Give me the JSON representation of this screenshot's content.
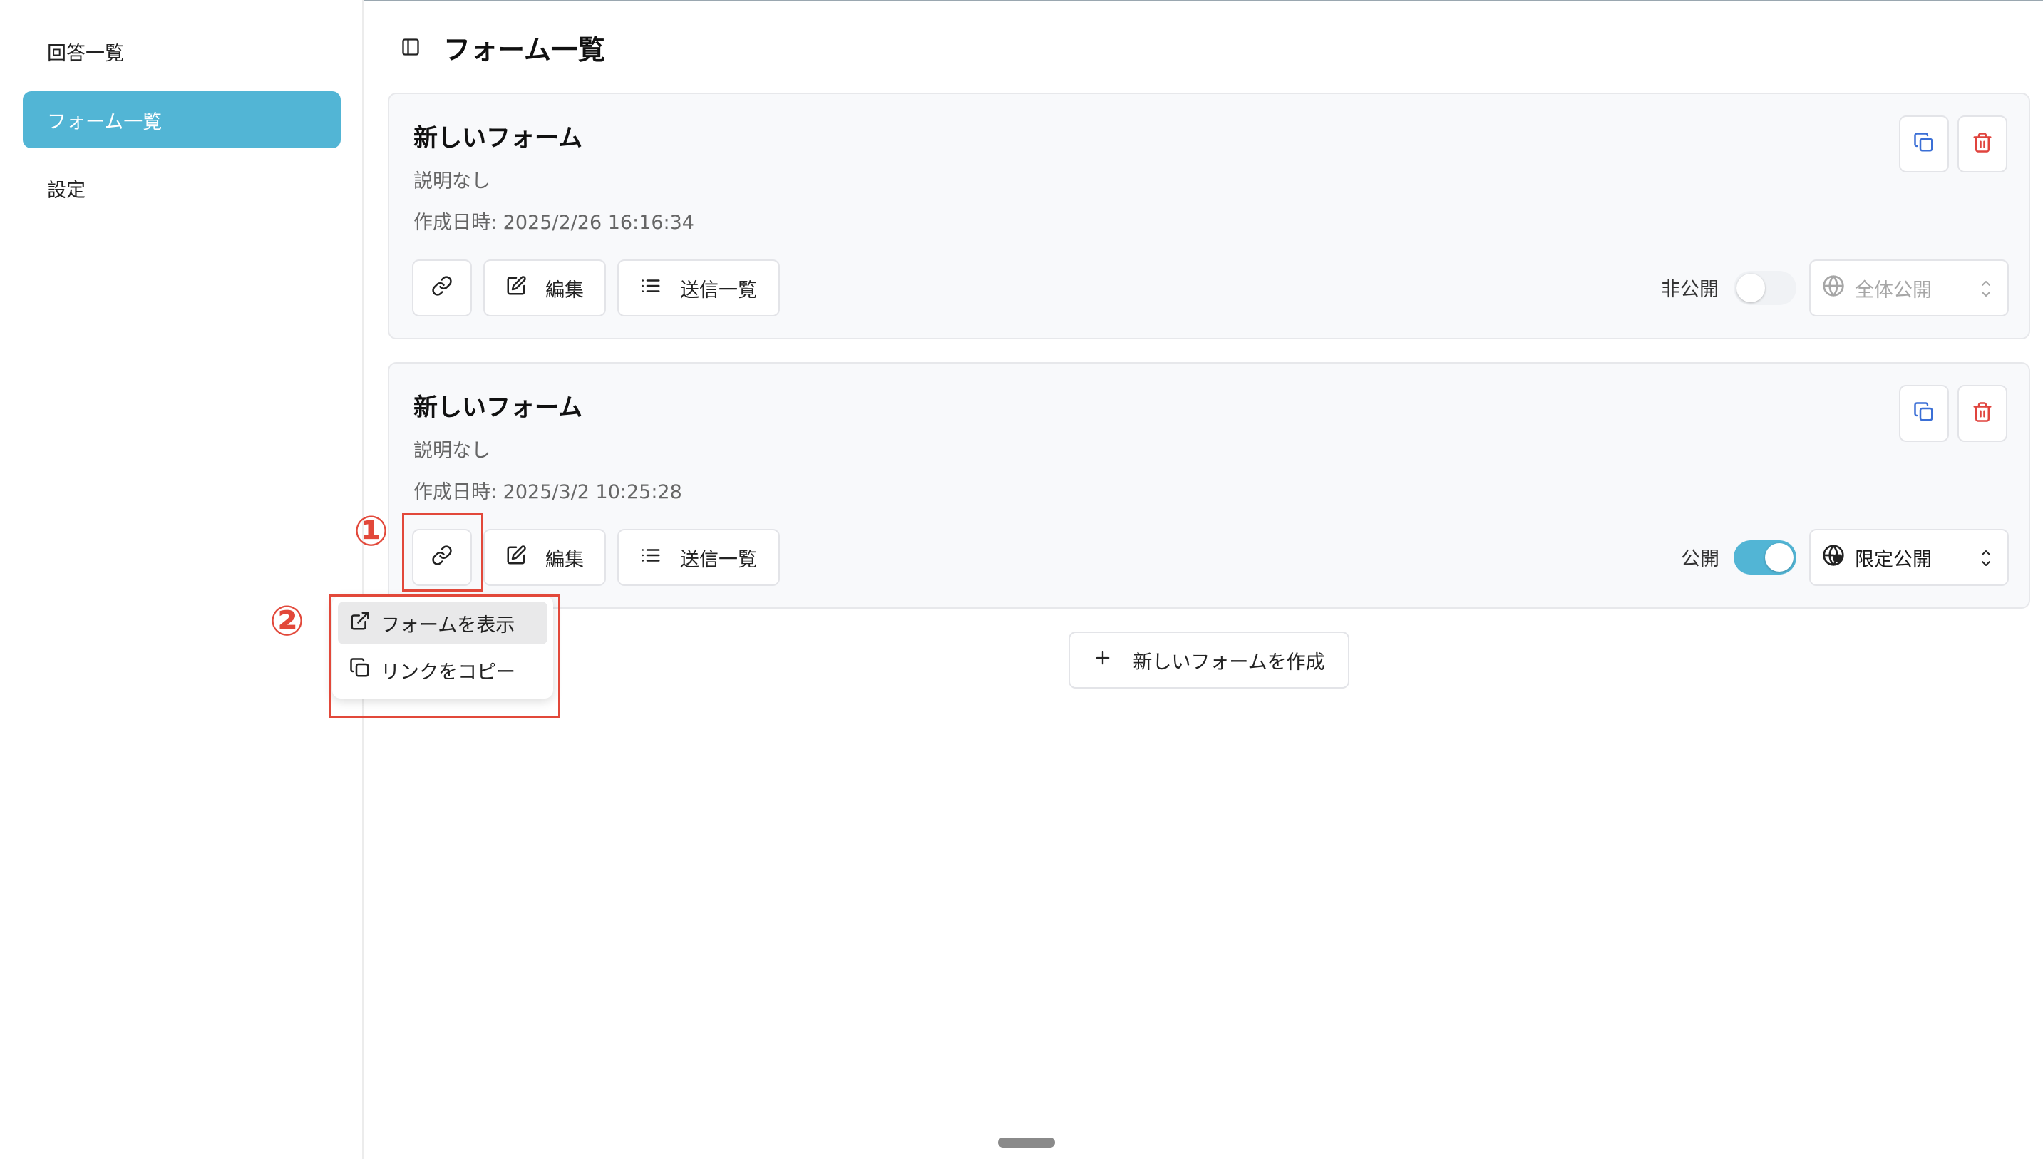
{
  "sidebar": {
    "items": [
      {
        "label": "回答一覧",
        "active": false
      },
      {
        "label": "フォーム一覧",
        "active": true
      },
      {
        "label": "設定",
        "active": false
      }
    ]
  },
  "header": {
    "title": "フォーム一覧",
    "toggle_icon": "sidebar-toggle-icon"
  },
  "forms": [
    {
      "title": "新しいフォーム",
      "description": "説明なし",
      "created": "作成日時: 2025/2/26 16:16:34",
      "edit_label": "編集",
      "submissions_label": "送信一覧",
      "status_label": "非公開",
      "published": false,
      "visibility": "全体公開"
    },
    {
      "title": "新しいフォーム",
      "description": "説明なし",
      "created": "作成日時: 2025/3/2 10:25:28",
      "edit_label": "編集",
      "submissions_label": "送信一覧",
      "status_label": "公開",
      "published": true,
      "visibility": "限定公開"
    }
  ],
  "link_menu": {
    "items": [
      {
        "label": "フォームを表示",
        "icon": "external-link-icon"
      },
      {
        "label": "リンクをコピー",
        "icon": "copy-icon"
      }
    ]
  },
  "create_button": {
    "label": "新しいフォームを作成"
  },
  "annotations": {
    "step1": "①",
    "step2": "②"
  },
  "colors": {
    "accent": "#52b5d5",
    "danger": "#e2483a",
    "copy_icon": "#3b6fd6",
    "delete_icon": "#e0443e"
  }
}
